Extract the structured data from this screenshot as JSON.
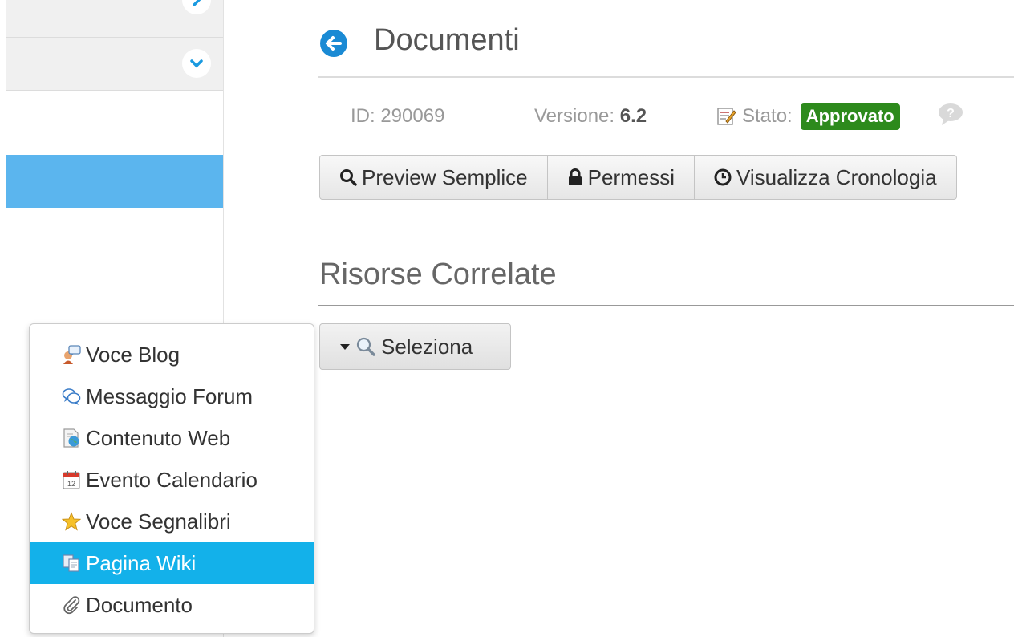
{
  "header": {
    "title": "Documenti"
  },
  "meta": {
    "id_text": "ID: 290069",
    "version_label": "Versione: ",
    "version_value": "6.2",
    "state_label": "Stato:",
    "state_badge": "Approvato"
  },
  "toolbar": {
    "preview_label": "Preview Semplice",
    "permissions_label": "Permessi",
    "history_label": "Visualizza Cronologia"
  },
  "related": {
    "title": "Risorse Correlate",
    "select_label": "Seleziona"
  },
  "menu": {
    "items": [
      {
        "label": "Voce Blog",
        "icon": "blog-icon"
      },
      {
        "label": "Messaggio Forum",
        "icon": "forum-icon"
      },
      {
        "label": "Contenuto Web",
        "icon": "web-content-icon"
      },
      {
        "label": "Evento Calendario",
        "icon": "calendar-icon"
      },
      {
        "label": "Voce Segnalibri",
        "icon": "star-icon"
      },
      {
        "label": "Pagina Wiki",
        "icon": "wiki-icon",
        "active": true
      },
      {
        "label": "Documento",
        "icon": "paperclip-icon"
      }
    ]
  },
  "colors": {
    "accent": "#13b1ea",
    "sidebar_active": "#5bb5ee",
    "badge": "#2d8a1c",
    "back_icon": "#1a8ad4"
  }
}
